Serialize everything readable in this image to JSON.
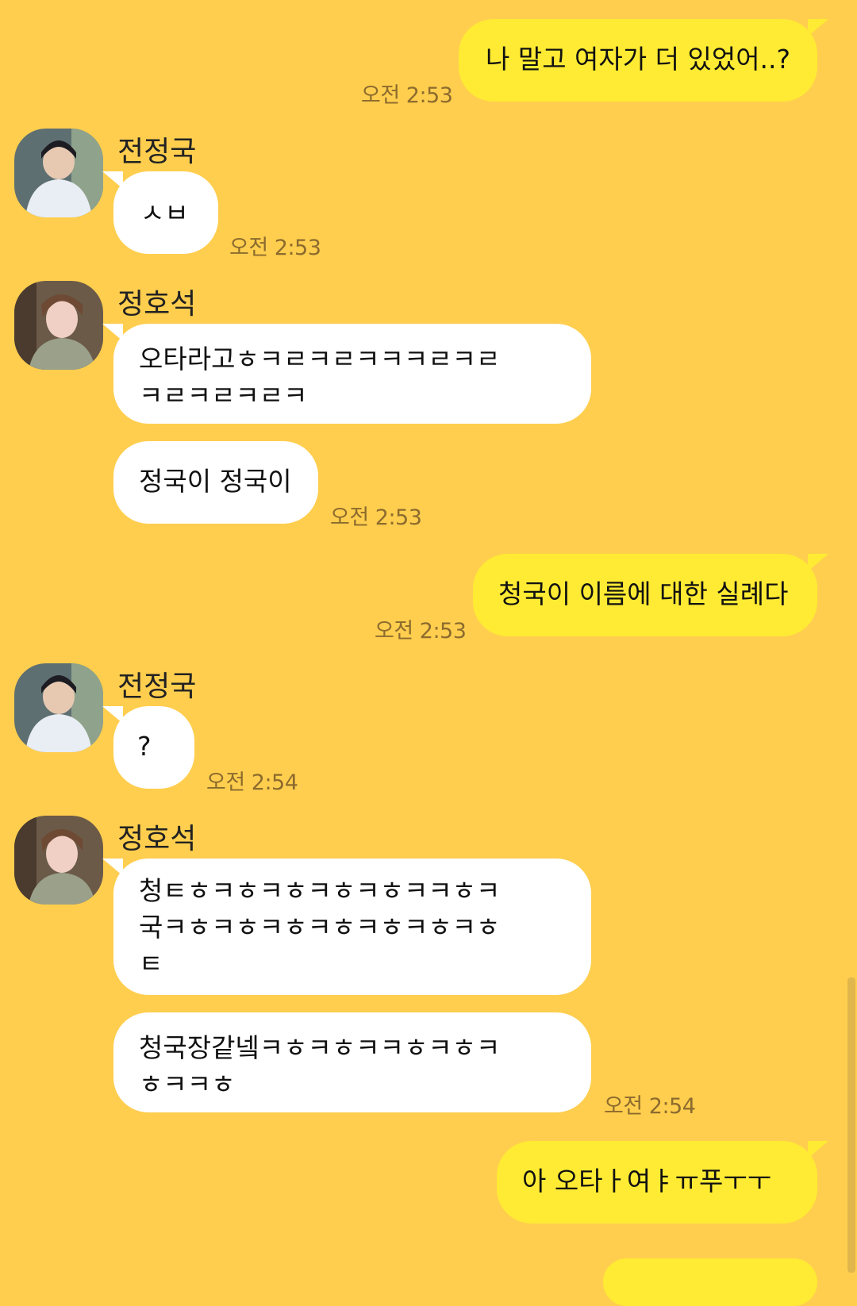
{
  "messages": [
    {
      "id": "m1",
      "direction": "out",
      "lines": [
        "나 말고 여자가 더 있었어..?"
      ],
      "time": "오전 2:53"
    },
    {
      "id": "m2",
      "direction": "in",
      "sender": "전정국",
      "lines": [
        "ㅅㅂ"
      ],
      "time": "오전 2:53"
    },
    {
      "id": "m3",
      "direction": "in",
      "sender": "정호석",
      "lines": [
        "오타라고ㅎㅋㄹㅋㄹㅋㅋㅋㄹㅋㄹ",
        "ㅋㄹㅋㄹㅋㄹㅋ"
      ]
    },
    {
      "id": "m4",
      "direction": "in",
      "lines": [
        "정국이 정국이"
      ],
      "time": "오전 2:53"
    },
    {
      "id": "m5",
      "direction": "out",
      "lines": [
        "청국이 이름에 대한 실례다"
      ],
      "time": "오전 2:53"
    },
    {
      "id": "m6",
      "direction": "in",
      "sender": "전정국",
      "lines": [
        "?"
      ],
      "time": "오전 2:54"
    },
    {
      "id": "m7",
      "direction": "in",
      "sender": "정호석",
      "lines": [
        "청ㅌㅎㅋㅎㅋㅎㅋㅎㅋㅎㅋㅋㅎㅋ",
        "국ㅋㅎㅋㅎㅋㅎㅋㅎㅋㅎㅋㅎㅋㅎ",
        "ㅌ"
      ]
    },
    {
      "id": "m8",
      "direction": "in",
      "lines": [
        "청국장같넼ㅋㅎㅋㅎㅋㅋㅎㅋㅎㅋ",
        "ㅎㅋㅋㅎ"
      ],
      "time": "오전 2:54"
    },
    {
      "id": "m9",
      "direction": "out",
      "lines": [
        "아 오타ㅏ여ㅑㅠ푸ㅜㅜ"
      ]
    }
  ],
  "colors": {
    "background": "#FFCE4E",
    "incoming_bubble": "#FFFFFF",
    "outgoing_bubble": "#FFEB33",
    "timestamp": "#8C6B2E"
  },
  "icons": {
    "avatar_jungkook": "profile-photo",
    "avatar_hoseok": "profile-photo"
  }
}
